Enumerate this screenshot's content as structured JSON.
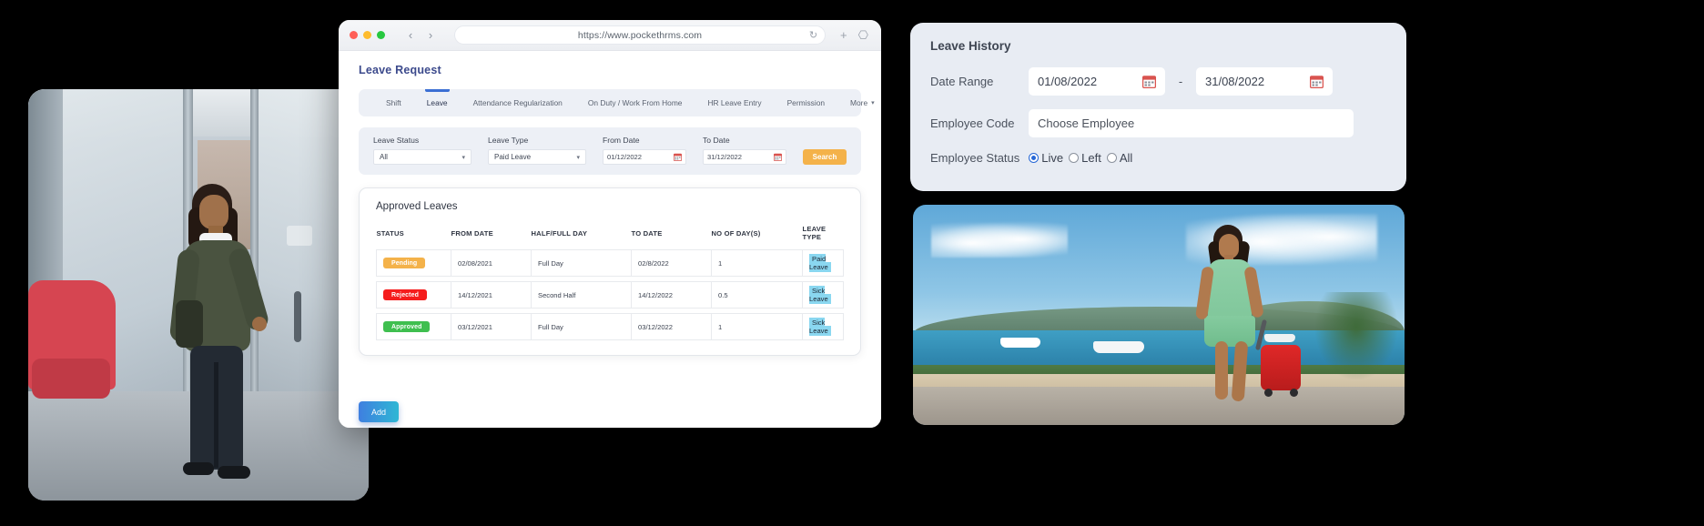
{
  "browser": {
    "url": "https://www.pockethrms.com",
    "reload_icon": "reload-icon",
    "new_tab_icon": "plus-icon",
    "tabs_overview_icon": "copy-icon",
    "back_icon": "chevron-left-icon",
    "forward_icon": "chevron-right-icon"
  },
  "page": {
    "title": "Leave Request",
    "tabs": [
      {
        "label": "Shift",
        "active": false
      },
      {
        "label": "Leave",
        "active": true
      },
      {
        "label": "Attendance Regularization",
        "active": false
      },
      {
        "label": "On Duty / Work From Home",
        "active": false
      },
      {
        "label": "HR Leave Entry",
        "active": false
      },
      {
        "label": "Permission",
        "active": false
      },
      {
        "label": "More",
        "active": false,
        "caret": "▾"
      }
    ],
    "filters": {
      "leave_status": {
        "label": "Leave Status",
        "value": "All"
      },
      "leave_type": {
        "label": "Leave Type",
        "value": "Paid Leave"
      },
      "from_date": {
        "label": "From Date",
        "value": "01/12/2022"
      },
      "to_date": {
        "label": "To Date",
        "value": "31/12/2022"
      },
      "search_button": "Search"
    },
    "table": {
      "title": "Approved Leaves",
      "columns": [
        "STATUS",
        "FROM DATE",
        "HALF/FULL DAY",
        "TO DATE",
        "NO OF DAY(S)",
        "LEAVE TYPE"
      ],
      "rows": [
        {
          "status": "Pending",
          "status_color": "#f4b24a",
          "from_date": "02/08/2021",
          "half_full_day": "Full Day",
          "to_date": "02/8/2022",
          "no_of_days": "1",
          "leave_type": "Paid Leave"
        },
        {
          "status": "Rejected",
          "status_color": "#f51d1d",
          "from_date": "14/12/2021",
          "half_full_day": "Second Half",
          "to_date": "14/12/2022",
          "no_of_days": "0.5",
          "leave_type": "Sick Leave"
        },
        {
          "status": "Approved",
          "status_color": "#3fbf4f",
          "from_date": "03/12/2021",
          "half_full_day": "Full Day",
          "to_date": "03/12/2022",
          "no_of_days": "1",
          "leave_type": "Sick Leave"
        }
      ]
    },
    "add_button": "Add"
  },
  "leave_history": {
    "title": "Leave History",
    "date_range": {
      "label": "Date Range",
      "from": "01/08/2022",
      "separator": "-",
      "to": "31/08/2022",
      "calendar_icon": "calendar-icon"
    },
    "employee_code": {
      "label": "Employee Code",
      "placeholder": "Choose Employee",
      "value": "Choose Employee"
    },
    "employee_status": {
      "label": "Employee Status",
      "options": [
        {
          "label": "Live",
          "selected": true
        },
        {
          "label": "Left",
          "selected": false
        },
        {
          "label": "All",
          "selected": false
        }
      ]
    }
  },
  "colors": {
    "accent_orange": "#f4b24a",
    "accent_blue": "#3b6fd4",
    "status_red": "#f51d1d",
    "status_green": "#3fbf4f",
    "leave_type_highlight": "#8ad7f0",
    "panel_bg": "#e8ecf3"
  }
}
